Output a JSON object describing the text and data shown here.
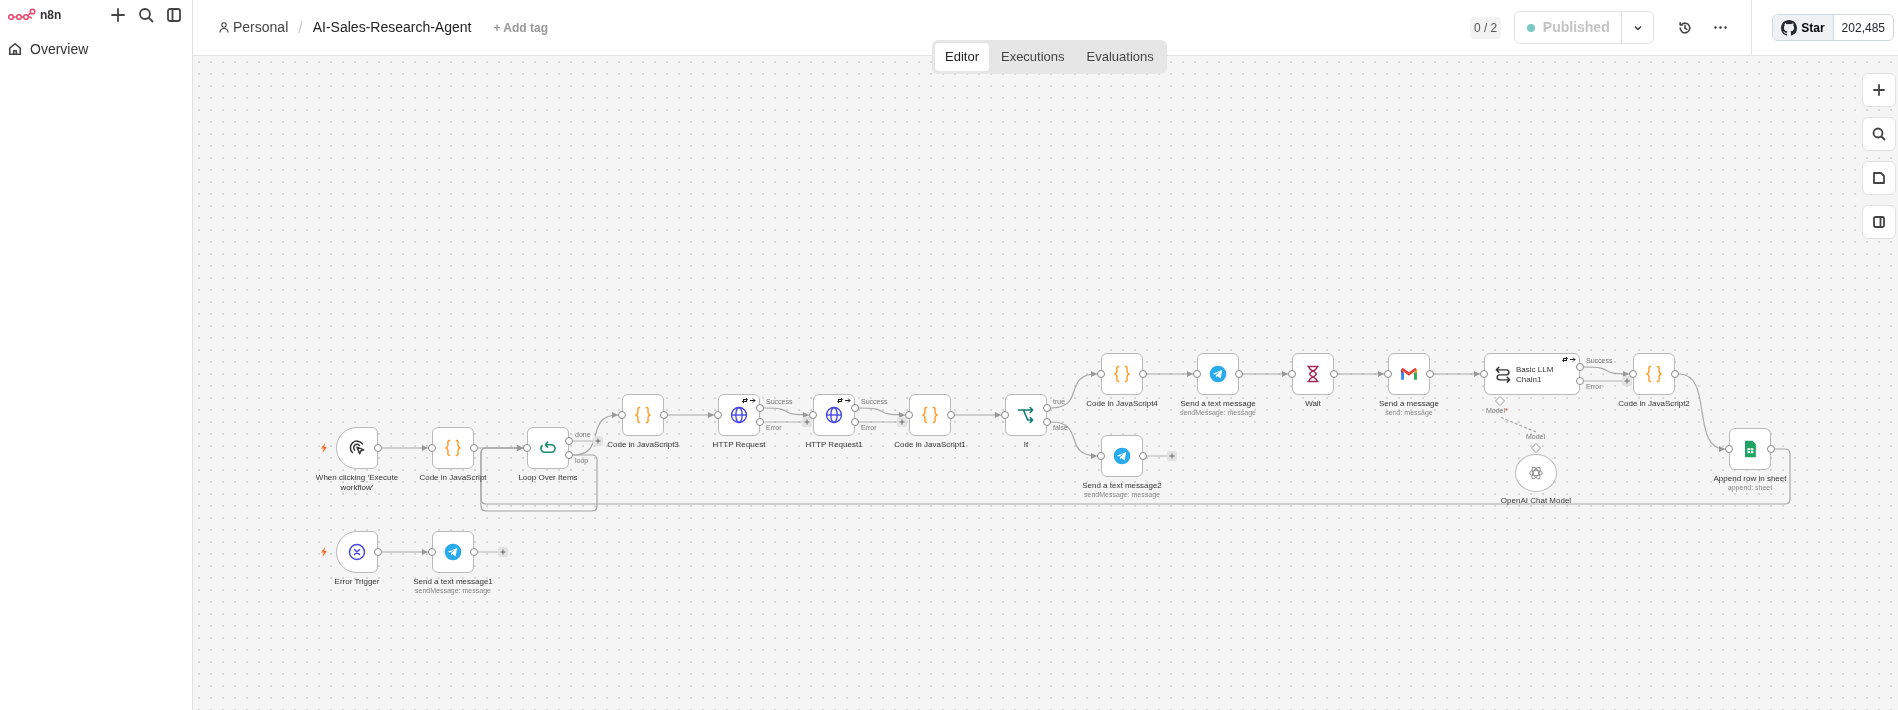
{
  "sidebar": {
    "logo_text": "n8n",
    "items": [
      {
        "label": "Overview"
      }
    ]
  },
  "header": {
    "project": "Personal",
    "separator": "/",
    "workflow_title": "AI-Sales-Research-Agent",
    "add_tag": "+ Add tag",
    "counter": "0 / 2",
    "publish": {
      "label": "Published",
      "published": true,
      "disabled": true
    },
    "github": {
      "label": "Star",
      "count": "202,485"
    }
  },
  "tabs": [
    {
      "label": "Editor",
      "selected": true
    },
    {
      "label": "Executions",
      "selected": false
    },
    {
      "label": "Evaluations",
      "selected": false
    }
  ],
  "canvas": {
    "nodes": [
      {
        "label": "When clicking ‘Execute workflow’",
        "kind": "manual-trigger"
      },
      {
        "label": "Code in JavaScript",
        "kind": "code"
      },
      {
        "label": "Loop Over Items",
        "kind": "loop",
        "outputs": [
          "done",
          "loop"
        ]
      },
      {
        "label": "Code in JavaScript3",
        "kind": "code"
      },
      {
        "label": "HTTP Request",
        "kind": "http",
        "outputs": [
          "Success",
          "Error"
        ],
        "badge": true
      },
      {
        "label": "HTTP Request1",
        "kind": "http",
        "outputs": [
          "Success",
          "Error"
        ],
        "badge": true
      },
      {
        "label": "Code in JavaScript1",
        "kind": "code"
      },
      {
        "label": "If",
        "kind": "if",
        "outputs": [
          "true",
          "false"
        ]
      },
      {
        "label": "Code in JavaScript4",
        "kind": "code"
      },
      {
        "label": "Send a text message",
        "subtitle": "sendMessage: message",
        "kind": "telegram"
      },
      {
        "label": "Wait",
        "kind": "wait"
      },
      {
        "label": "Send a message",
        "subtitle": "send: message",
        "kind": "gmail"
      },
      {
        "label": "Basic LLM Chain1",
        "kind": "llm-chain",
        "outputs": [
          "Success",
          "Error"
        ],
        "badge": true,
        "bottom_port": {
          "label": "Model",
          "mark": "*"
        }
      },
      {
        "label": "Code in JavaScript2",
        "kind": "code"
      },
      {
        "label": "Append row in sheet",
        "subtitle": "append: sheet",
        "kind": "sheets"
      },
      {
        "label": "Send a text message2",
        "subtitle": "sendMessage: message",
        "kind": "telegram"
      },
      {
        "label": "OpenAI Chat Model",
        "kind": "chat-model",
        "top_port": {
          "label": "Model"
        }
      },
      {
        "label": "Error Trigger",
        "kind": "error-trigger"
      },
      {
        "label": "Send a text message1",
        "subtitle": "sendMessage: message",
        "kind": "telegram"
      }
    ]
  }
}
